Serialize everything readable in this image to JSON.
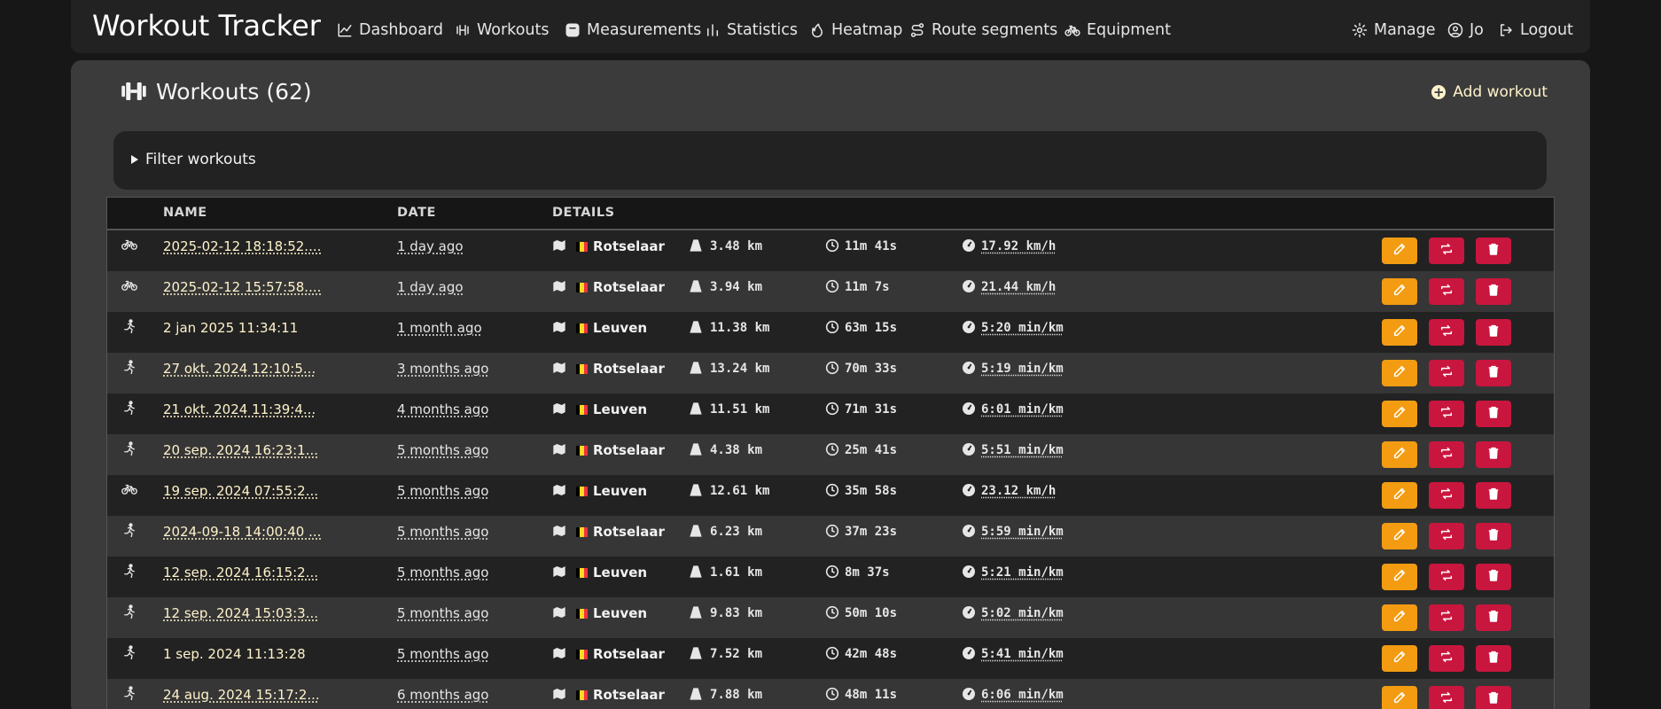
{
  "app": {
    "title": "Workout Tracker"
  },
  "nav": {
    "items": [
      {
        "label": "Dashboard",
        "icon": "chart-line-icon"
      },
      {
        "label": "Workouts",
        "icon": "dumbbell-icon"
      },
      {
        "label": "Measurements",
        "icon": "weight-scale-icon"
      },
      {
        "label": "Statistics",
        "icon": "bar-chart-icon"
      },
      {
        "label": "Heatmap",
        "icon": "fire-icon"
      },
      {
        "label": "Route segments",
        "icon": "route-icon"
      },
      {
        "label": "Equipment",
        "icon": "bicycle-icon"
      }
    ],
    "right": [
      {
        "label": "Manage",
        "icon": "gear-icon"
      },
      {
        "label": "Jo",
        "icon": "user-icon"
      },
      {
        "label": "Logout",
        "icon": "logout-icon"
      }
    ]
  },
  "page": {
    "title": "Workouts (62)",
    "add_label": "Add workout"
  },
  "filter": {
    "label": "Filter workouts"
  },
  "table": {
    "headers": {
      "name": "NAME",
      "date": "DATE",
      "details": "DETAILS"
    },
    "rows": [
      {
        "type": "bike",
        "name": "2025-02-12 18:18:52....",
        "name_linked": true,
        "date": "1 day ago",
        "location": "Rotselaar",
        "distance": "3.48 km",
        "duration": "11m 41s",
        "speed": "17.92 km/h"
      },
      {
        "type": "bike",
        "name": "2025-02-12 15:57:58....",
        "name_linked": true,
        "date": "1 day ago",
        "location": "Rotselaar",
        "distance": "3.94 km",
        "duration": "11m 7s",
        "speed": "21.44 km/h"
      },
      {
        "type": "run",
        "name": "2 jan 2025 11:34:11",
        "name_linked": false,
        "date": "1 month ago",
        "location": "Leuven",
        "distance": "11.38 km",
        "duration": "63m 15s",
        "speed": " 5:20 min/km"
      },
      {
        "type": "run",
        "name": "27 okt. 2024 12:10:5...",
        "name_linked": true,
        "date": "3 months ago",
        "location": "Rotselaar",
        "distance": "13.24 km",
        "duration": "70m 33s",
        "speed": " 5:19 min/km"
      },
      {
        "type": "run",
        "name": "21 okt. 2024 11:39:4...",
        "name_linked": true,
        "date": "4 months ago",
        "location": "Leuven",
        "distance": "11.51 km",
        "duration": "71m 31s",
        "speed": " 6:01 min/km"
      },
      {
        "type": "run",
        "name": "20 sep. 2024 16:23:1...",
        "name_linked": true,
        "date": "5 months ago",
        "location": "Rotselaar",
        "distance": "4.38 km",
        "duration": "25m 41s",
        "speed": " 5:51 min/km"
      },
      {
        "type": "bike",
        "name": "19 sep. 2024 07:55:2...",
        "name_linked": true,
        "date": "5 months ago",
        "location": "Leuven",
        "distance": "12.61 km",
        "duration": "35m 58s",
        "speed": "23.12 km/h"
      },
      {
        "type": "run",
        "name": "2024-09-18 14:00:40 ...",
        "name_linked": true,
        "date": "5 months ago",
        "location": "Rotselaar",
        "distance": "6.23 km",
        "duration": "37m 23s",
        "speed": " 5:59 min/km"
      },
      {
        "type": "run",
        "name": "12 sep. 2024 16:15:2...",
        "name_linked": true,
        "date": "5 months ago",
        "location": "Leuven",
        "distance": "1.61 km",
        "duration": "8m 37s",
        "speed": " 5:21 min/km"
      },
      {
        "type": "run",
        "name": "12 sep. 2024 15:03:3...",
        "name_linked": true,
        "date": "5 months ago",
        "location": "Leuven",
        "distance": "9.83 km",
        "duration": "50m 10s",
        "speed": " 5:02 min/km"
      },
      {
        "type": "run",
        "name": "1 sep. 2024 11:13:28",
        "name_linked": false,
        "date": "5 months ago",
        "location": "Rotselaar",
        "distance": "7.52 km",
        "duration": "42m 48s",
        "speed": " 5:41 min/km"
      },
      {
        "type": "run",
        "name": "24 aug. 2024 15:17:2...",
        "name_linked": true,
        "date": "6 months ago",
        "location": "Rotselaar",
        "distance": "7.88 km",
        "duration": "48m 11s",
        "speed": " 6:06 min/km"
      }
    ]
  },
  "colors": {
    "edit": "#f39c12",
    "action": "#c9163e",
    "link": "#fff3cc"
  }
}
